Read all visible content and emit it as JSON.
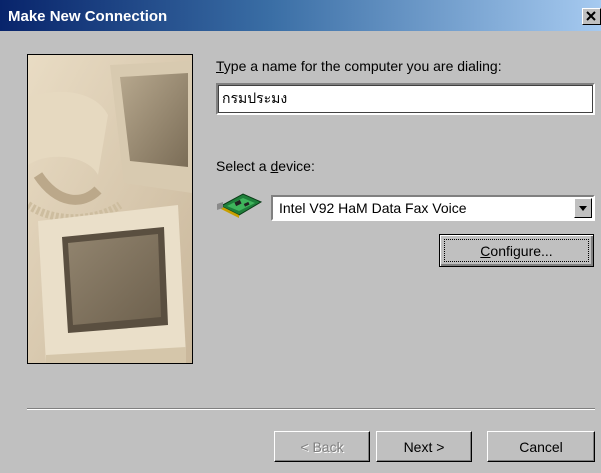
{
  "window": {
    "title": "Make New Connection",
    "close_icon": "close-icon"
  },
  "form": {
    "name_label": "Type a name for the computer you are dialing:",
    "name_label_mnemonic": "T",
    "name_value": "กรมประมง",
    "device_label": "Select a device:",
    "device_label_mnemonic": "d",
    "device_icon": "modem-card-icon",
    "device_selected": "Intel V92 HaM Data Fax Voice",
    "configure_label": "Configure...",
    "configure_mnemonic": "C"
  },
  "footer": {
    "back_label": "< Back",
    "next_label": "Next >",
    "cancel_label": "Cancel"
  },
  "colors": {
    "dialog_face": "#c0c0c0",
    "title_start": "#08246b",
    "title_end": "#a6caf0"
  }
}
